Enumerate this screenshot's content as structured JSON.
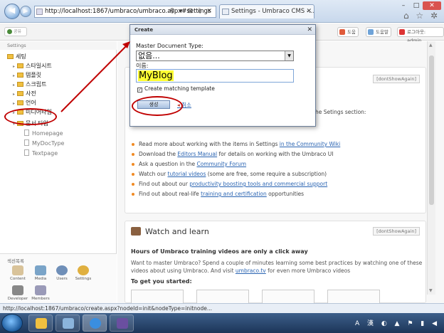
{
  "browser": {
    "address": "http://localhost:1867/umbraco/umbraco.aspx#settings",
    "address_icons": "⚲ ▾ ⊠ ¢ ✕",
    "tab_title": "Settings - Umbraco CMS -...",
    "tab_close": "✕",
    "window_controls": [
      "–",
      "□",
      "✕"
    ],
    "toolbar_icons": "⌂ ☆ ✲",
    "status_url": "http://localhost:1867/umbraco/create.aspx?nodeId=init&nodeType=initnode..."
  },
  "header": {
    "logo_label": "공유",
    "help_label": "도움",
    "tour_label": "도움말",
    "logout_label": "로그아웃: admin"
  },
  "sidebar": {
    "title": "Settings",
    "tree": [
      {
        "label": "세팅",
        "kind": "root"
      },
      {
        "label": "스타일시트",
        "kind": "folder"
      },
      {
        "label": "템플릿",
        "kind": "folder"
      },
      {
        "label": "스크립트",
        "kind": "folder"
      },
      {
        "label": "사전",
        "kind": "folder"
      },
      {
        "label": "언어",
        "kind": "folder"
      },
      {
        "label": "미디어타입",
        "kind": "folder"
      },
      {
        "label": "문서 타입",
        "kind": "folder-open"
      },
      {
        "label": "Homepage",
        "kind": "doc"
      },
      {
        "label": "MyDocType",
        "kind": "doc"
      },
      {
        "label": "Textpage",
        "kind": "doc"
      }
    ],
    "sections_title": "섹션목록",
    "sections": [
      "Content",
      "Media",
      "Users",
      "Settings",
      "Developer",
      "Members"
    ]
  },
  "main": {
    "dont_show_again": "[dontShowAgain]",
    "settings_intro_tail": "the Setings section:",
    "guide_items": [
      {
        "pre": "Read more about working with the items in Settings ",
        "link": "in the Community Wiki",
        "post": ""
      },
      {
        "pre": "Download the ",
        "link": "Editors Manual",
        "post": " for details on working with the Umbraco UI"
      },
      {
        "pre": "Ask a question in the ",
        "link": "Community Forum",
        "post": ""
      },
      {
        "pre": "Watch our ",
        "link": "tutorial videos",
        "post": " (some are free, some require a subscription)"
      },
      {
        "pre": "Find out about our ",
        "link": "productivity boosting tools and commercial support",
        "post": ""
      },
      {
        "pre": "Find out about real-life ",
        "link": "training and certification",
        "post": " opportunities"
      }
    ],
    "watch": {
      "title": "Watch and learn",
      "subtitle": "Hours of Umbraco training videos are only a click away",
      "body_1": "Want to master Umbraco? Spend a couple of minutes learning some best practices by watching one of these",
      "body_2_pre": "videos about using Umbraco. And visit ",
      "body_2_link": "umbraco.tv",
      "body_2_post": " for even more Umbraco videos",
      "get_started": "To get you started:"
    }
  },
  "dialog": {
    "title": "Create",
    "close": "✕",
    "doc_type_label": "Master Document Type:",
    "doc_type_value": "없음...",
    "name_label": "이름:",
    "name_value": "MyBlog",
    "check_label": "Create matching template",
    "check_mark": "✓",
    "create_button": "생성",
    "cancel_link": "취소"
  },
  "colors": {
    "annotation_red": "#c00000",
    "link_blue": "#2a64b2",
    "highlight_yellow": "#ffff33"
  }
}
